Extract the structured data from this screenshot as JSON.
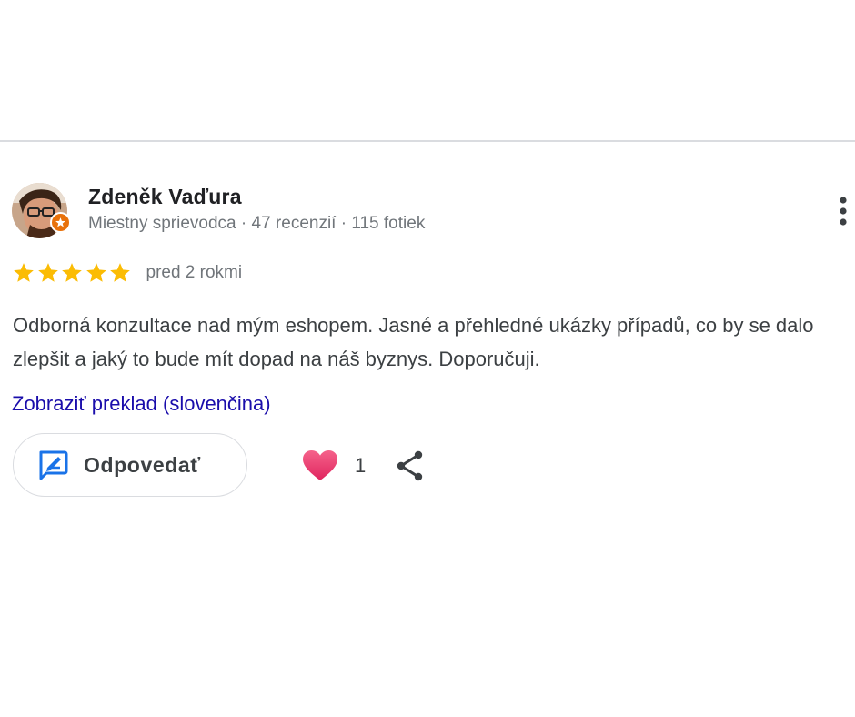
{
  "review": {
    "author": {
      "name": "Zdeněk Vaďura",
      "meta": "Miestny sprievodca · 47 recenzií · 115 fotiek"
    },
    "rating": 5,
    "rating_max": 5,
    "time": "pred 2 rokmi",
    "text": "Odborná konzultace nad mým eshopem. Jasné a přehledné ukázky případů, co by se dalo zlepšit a jaký to bude mít dopad na náš byznys. Doporučuji.",
    "translate_link": "Zobraziť preklad (slovenčina)",
    "actions": {
      "reply_label": "Odpovedať",
      "like_count": "1"
    }
  },
  "colors": {
    "star": "#fbbc04",
    "link": "#1a0dab",
    "badge": "#e8710a",
    "reply_icon": "#1a73e8",
    "heart": "#e8336c"
  },
  "icons": {
    "more": "more-vert-icon",
    "star": "star-icon",
    "reply": "reply-icon",
    "heart": "heart-icon",
    "share": "share-icon",
    "badge": "local-guide-badge-icon"
  }
}
